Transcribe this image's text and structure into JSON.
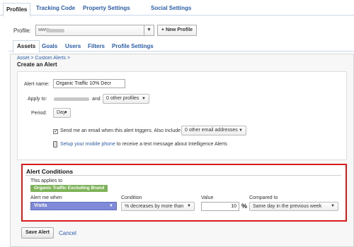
{
  "top_tabs": [
    {
      "label": "Profiles"
    },
    {
      "label": "Tracking Code"
    },
    {
      "label": "Property Settings"
    },
    {
      "label": "Social Settings"
    }
  ],
  "profile": {
    "label": "Profile:",
    "value": "www.",
    "new_profile_label": "+ New Profile"
  },
  "sub_tabs": [
    {
      "label": "Assets"
    },
    {
      "label": "Goals"
    },
    {
      "label": "Users"
    },
    {
      "label": "Filters"
    },
    {
      "label": "Profile Settings"
    }
  ],
  "breadcrumb": "Asset > Custom Alerts >",
  "page_title": "Create an Alert",
  "form": {
    "alert_name_label": "Alert name:",
    "alert_name_value": "Organic Traffic 10% Decr",
    "apply_to_label": "Apply to:",
    "apply_to_and": "and",
    "other_profiles": "0 other profiles",
    "period_label": "Period:",
    "period_value": "Day",
    "email_checked": true,
    "email_text": "Send me an email when this alert triggers. Also include",
    "other_emails": "0 other email addresses",
    "mobile_link": "Setup your mobile phone",
    "mobile_text": "to receive a text message about Intelligence Alerts"
  },
  "conditions": {
    "title": "Alert Conditions",
    "applies_to_label": "This applies to",
    "segment": "Organic Traffic Excluding Brand",
    "alert_when_label": "Alert me when",
    "metric": "Visits",
    "condition_label": "Condition",
    "condition_value": "% decreases by more than",
    "value_label": "Value",
    "value": "10",
    "value_unit": "%",
    "compared_label": "Compared to",
    "compared_value": "Same day in the previous week"
  },
  "footer": {
    "save_label": "Save Alert",
    "cancel_label": "Cancel"
  },
  "colors": {
    "link": "#2a5db0",
    "highlight_border": "#d81b1b",
    "segment_green": "#7fb35a",
    "metric_blue": "#7f8ad8"
  }
}
